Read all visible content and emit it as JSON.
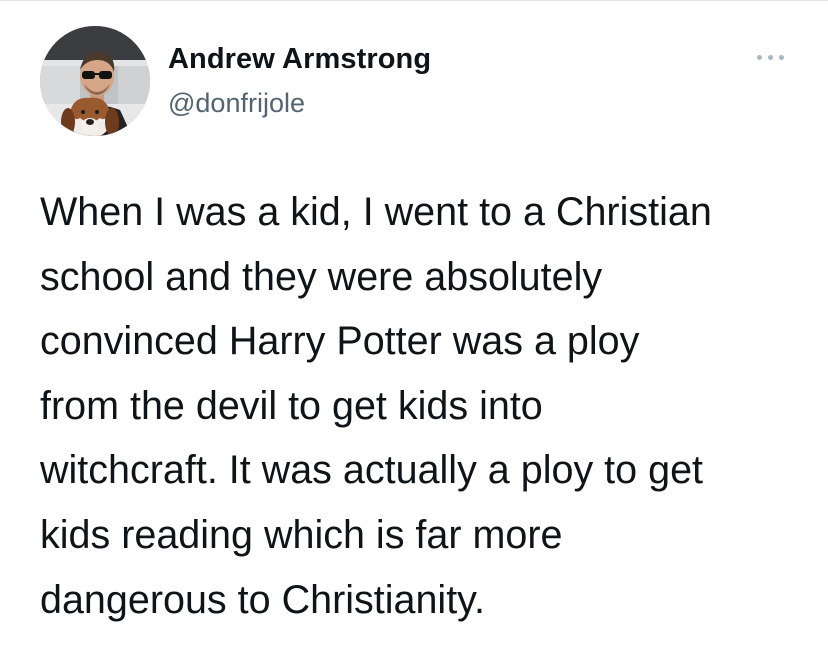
{
  "tweet": {
    "author": {
      "display_name": "Andrew Armstrong",
      "handle": "@donfrijole",
      "avatar_icon": "profile-photo-man-with-sunglasses-and-basset-hound"
    },
    "more_icon": "more-options-ellipsis-icon",
    "text_lines": [
      "When I was a kid, I went to a Christian",
      "school and they were absolutely",
      "convinced Harry Potter was a ploy",
      "from the devil to get kids into",
      "witchcraft. It was actually a ploy to get",
      "kids reading which is far more",
      "dangerous to Christianity."
    ]
  },
  "colors": {
    "text": "#0f1419",
    "secondary_text": "#536471",
    "icon_gray": "#aab8c2",
    "background": "#ffffff"
  }
}
